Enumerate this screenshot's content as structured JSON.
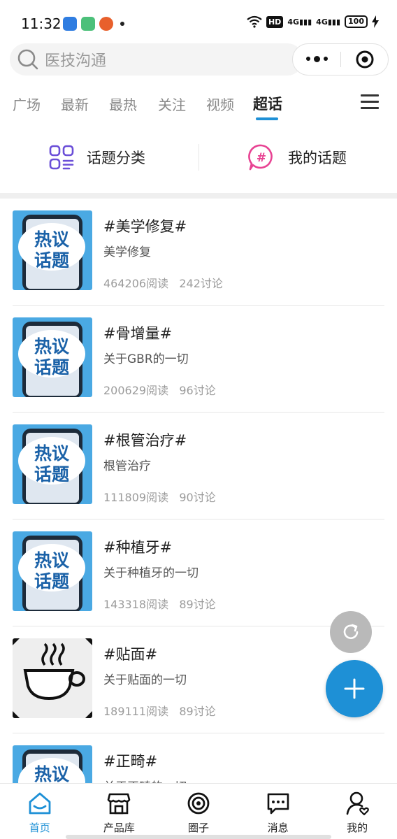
{
  "status_bar": {
    "time": "11:32",
    "hd": "HD",
    "signal_1": "4G",
    "signal_2": "4G",
    "battery": "100"
  },
  "search": {
    "placeholder": "医技沟通"
  },
  "tabs": [
    {
      "label": "广场"
    },
    {
      "label": "最新"
    },
    {
      "label": "最热"
    },
    {
      "label": "关注"
    },
    {
      "label": "视频"
    },
    {
      "label": "超话",
      "active": true
    }
  ],
  "categories": [
    {
      "label": "话题分类",
      "icon": "category-grid-icon",
      "color": "#6b4fd8"
    },
    {
      "label": "我的话题",
      "icon": "hashtag-bubble-icon",
      "color": "#e84393"
    }
  ],
  "thumb_text": {
    "line1": "热议",
    "line2": "话题"
  },
  "topics": [
    {
      "title": "#美学修复#",
      "desc": "美学修复",
      "reads": "464206阅读",
      "discussions": "242讨论",
      "thumb": "hot-topic"
    },
    {
      "title": "#骨增量#",
      "desc": "关于GBR的一切",
      "reads": "200629阅读",
      "discussions": "96讨论",
      "thumb": "hot-topic"
    },
    {
      "title": "#根管治疗#",
      "desc": "根管治疗",
      "reads": "111809阅读",
      "discussions": "90讨论",
      "thumb": "hot-topic"
    },
    {
      "title": "#种植牙#",
      "desc": "关于种植牙的一切",
      "reads": "143318阅读",
      "discussions": "89讨论",
      "thumb": "hot-topic"
    },
    {
      "title": "#贴面#",
      "desc": "关于贴面的一切",
      "reads": "189111阅读",
      "discussions": "89讨论",
      "thumb": "coffee-cup"
    },
    {
      "title": "#正畸#",
      "desc": "关于正畸的一切",
      "reads": "",
      "discussions": "",
      "thumb": "hot-topic"
    }
  ],
  "bottom_nav": [
    {
      "label": "首页",
      "icon": "home-icon",
      "active": true
    },
    {
      "label": "产品库",
      "icon": "store-icon"
    },
    {
      "label": "圈子",
      "icon": "circle-target-icon"
    },
    {
      "label": "消息",
      "icon": "message-icon"
    },
    {
      "label": "我的",
      "icon": "profile-icon"
    }
  ],
  "colors": {
    "accent": "#1e90d6",
    "thumb_bg": "#4aa9e3",
    "thumb_text": "#1b62a8"
  }
}
